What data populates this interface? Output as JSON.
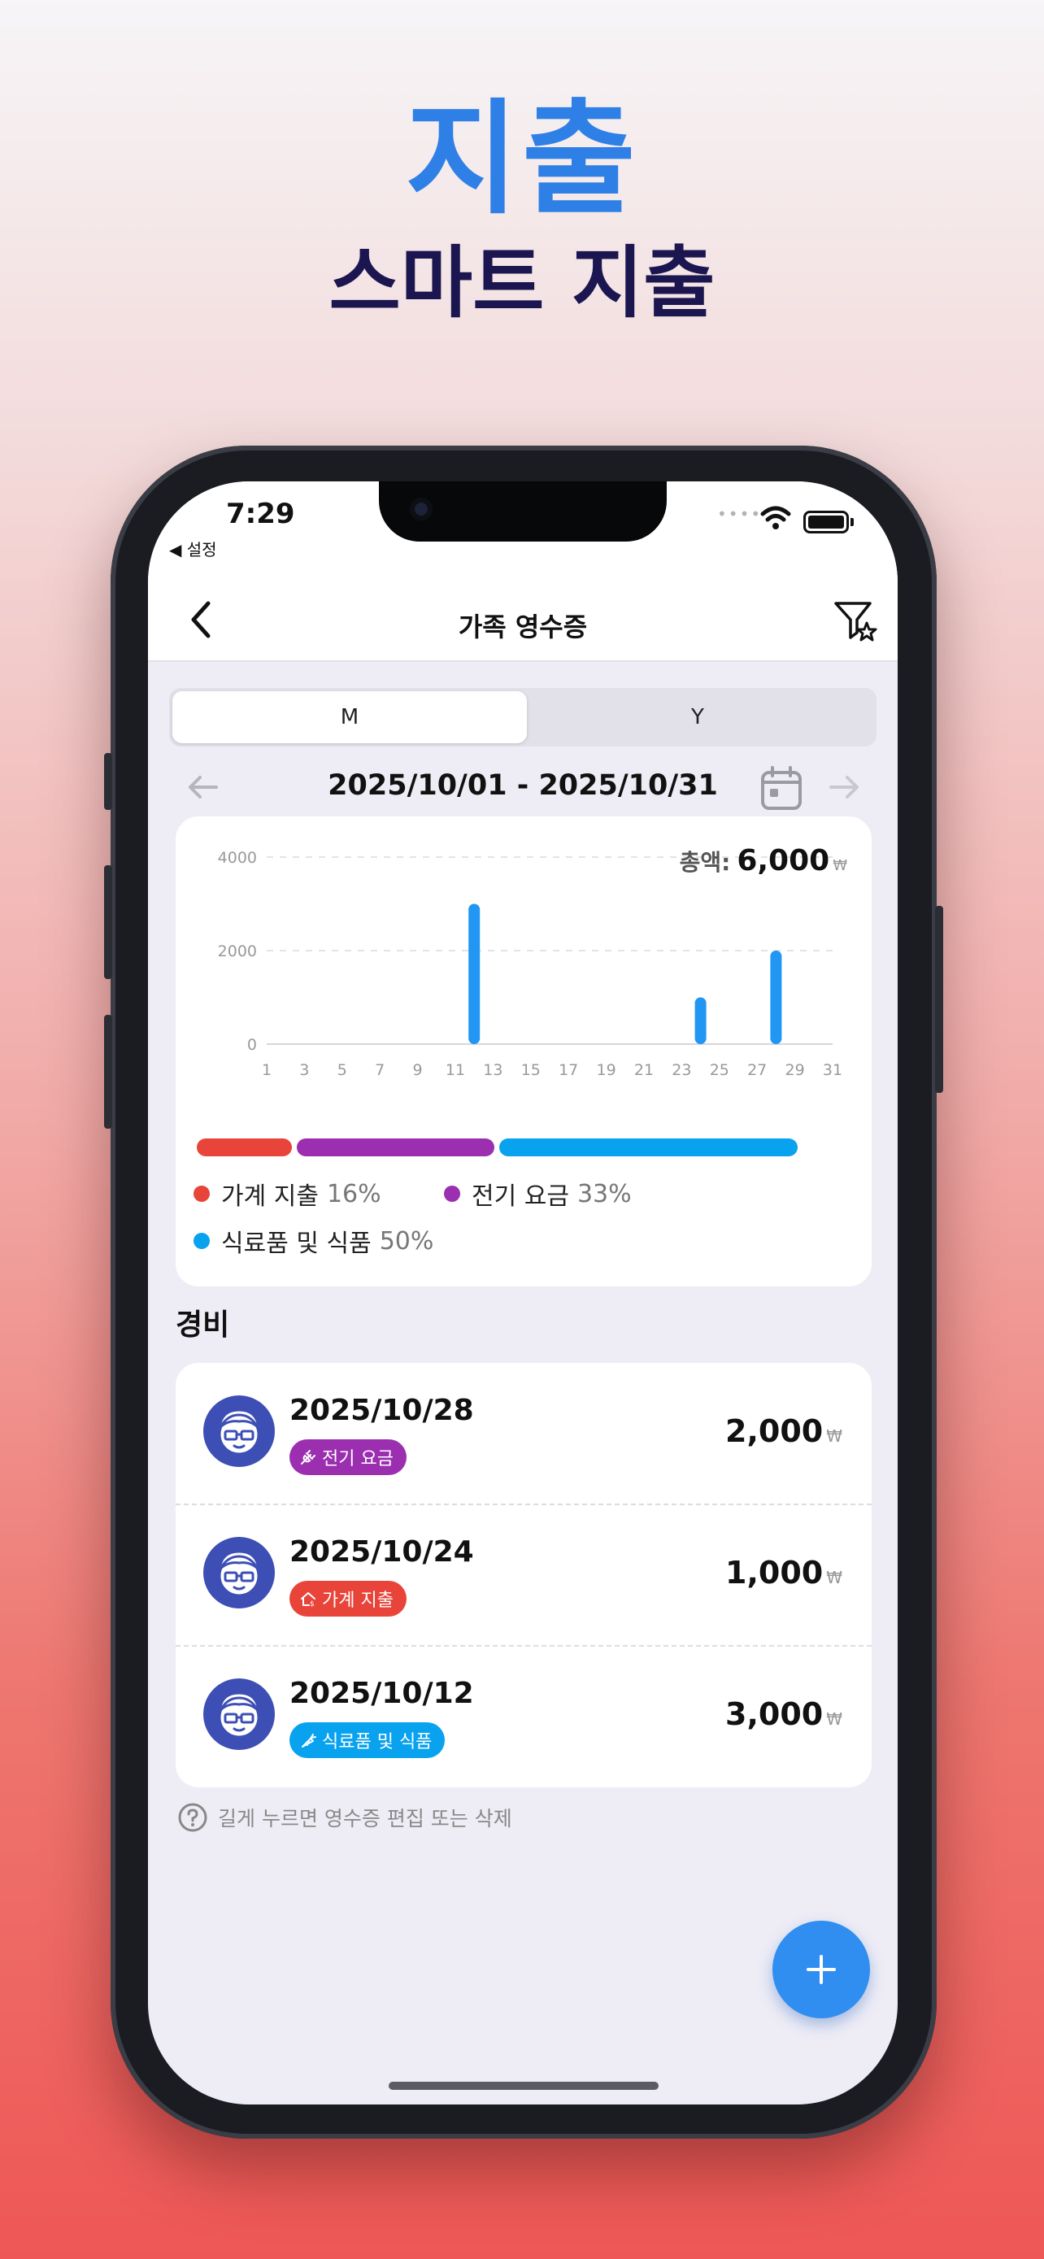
{
  "hero": {
    "title": "지출",
    "subtitle": "스마트 지출"
  },
  "status_bar": {
    "time": "7:29",
    "back_label": "◀ 설정"
  },
  "nav": {
    "title": "가족 영수증",
    "back_icon": "chevron-left-icon",
    "filter_icon": "filter-star-icon"
  },
  "segment": {
    "options": [
      "M",
      "Y"
    ],
    "selected": "M"
  },
  "period": {
    "range": "2025/10/01 - 2025/10/31"
  },
  "summary": {
    "total_label": "총액:",
    "total_value": "6,000",
    "currency": "₩"
  },
  "chart_data": {
    "type": "bar",
    "x_tick_labels": [
      "1",
      "3",
      "5",
      "7",
      "9",
      "11",
      "13",
      "15",
      "17",
      "19",
      "21",
      "23",
      "25",
      "27",
      "29",
      "31"
    ],
    "y_tick_labels": [
      "4000",
      "2000",
      "0"
    ],
    "ylim": [
      0,
      4000
    ],
    "xlim": [
      1,
      31
    ],
    "grid": true,
    "points": [
      {
        "day": 12,
        "value": 3000
      },
      {
        "day": 24,
        "value": 1000
      },
      {
        "day": 28,
        "value": 2000
      }
    ],
    "bar_color": "#2196f3"
  },
  "categories": [
    {
      "name": "가계 지출",
      "percent": "16%",
      "share": 16,
      "color": "#e8443a"
    },
    {
      "name": "전기 요금",
      "percent": "33%",
      "share": 33,
      "color": "#9b2fb0"
    },
    {
      "name": "식료품 및 식품",
      "percent": "50%",
      "share": 50,
      "color": "#08a2ee"
    }
  ],
  "section": {
    "title": "경비"
  },
  "expenses": [
    {
      "date": "2025/10/28",
      "category": "전기 요금",
      "color": "#9b2fb0",
      "icon": "plug-icon",
      "amount": "2,000",
      "currency": "₩"
    },
    {
      "date": "2025/10/24",
      "category": "가계 지출",
      "color": "#e8443a",
      "icon": "house-money-icon",
      "amount": "1,000",
      "currency": "₩"
    },
    {
      "date": "2025/10/12",
      "category": "식료품 및 식품",
      "color": "#08a2ee",
      "icon": "carrot-icon",
      "amount": "3,000",
      "currency": "₩"
    }
  ],
  "hint": {
    "text": "길게 누르면 영수증 편집 또는 삭제"
  },
  "fab": {
    "icon": "plus-icon"
  }
}
